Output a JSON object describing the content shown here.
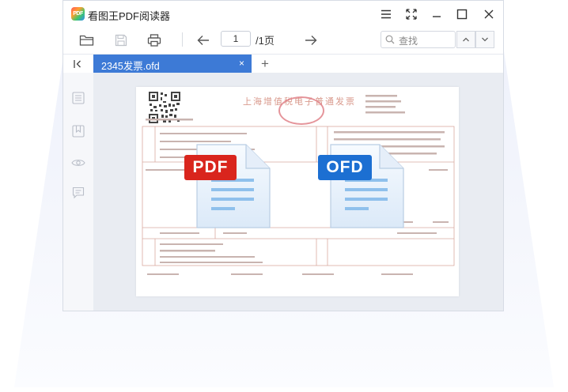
{
  "app": {
    "logo_text": "PDF",
    "title": "看图王PDF阅读器"
  },
  "toolbar": {
    "page_current": "1",
    "page_total": "/1页",
    "search_placeholder": "查找"
  },
  "tabs": {
    "active_label": "2345发票.ofd",
    "close_glyph": "×",
    "add_glyph": "+"
  },
  "invoice": {
    "title": "上海增值税电子普通发票"
  },
  "badges": {
    "pdf": "PDF",
    "ofd": "OFD"
  },
  "colors": {
    "accent": "#3d7ad6",
    "pdf_badge": "#d9251d",
    "ofd_badge": "#1c6fd2"
  }
}
